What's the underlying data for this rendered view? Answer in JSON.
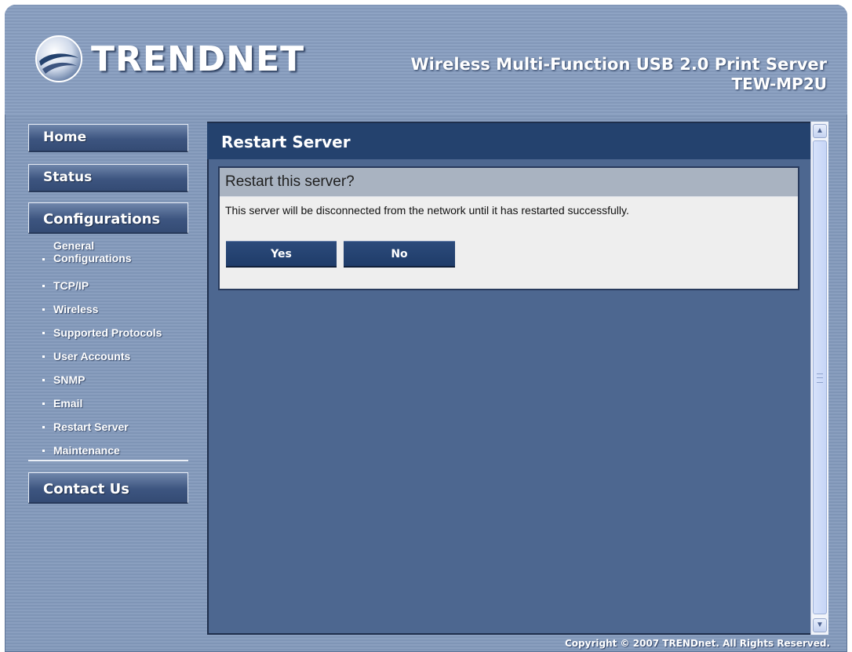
{
  "brand": {
    "logo_text": "TRENDNET",
    "logo_icon": "trendnet-globe-logo"
  },
  "product": {
    "name": "Wireless Multi-Function USB 2.0 Print Server",
    "model": "TEW-MP2U"
  },
  "nav": {
    "home": "Home",
    "status": "Status",
    "configurations": "Configurations",
    "contact": "Contact Us",
    "sub_items": [
      {
        "label_line1": "General",
        "label_line2": "Configurations"
      },
      {
        "label": "TCP/IP"
      },
      {
        "label": "Wireless"
      },
      {
        "label": "Supported Protocols"
      },
      {
        "label": "User Accounts"
      },
      {
        "label": "SNMP"
      },
      {
        "label": "Email"
      },
      {
        "label": "Restart Server"
      },
      {
        "label": "Maintenance"
      }
    ]
  },
  "main": {
    "title": "Restart Server",
    "dialog": {
      "heading": "Restart this server?",
      "message": "This server will be disconnected from the network until it has restarted successfully.",
      "yes_label": "Yes",
      "no_label": "No"
    }
  },
  "footer": {
    "copyright": "Copyright © 2007 TRENDnet. All Rights Reserved."
  },
  "colors": {
    "panel_bg": "#4d6790",
    "title_bar": "#24426e",
    "nav_button": "#3d5580",
    "dialog_bg": "#eeeeee",
    "dialog_head": "#a9b3c1"
  }
}
